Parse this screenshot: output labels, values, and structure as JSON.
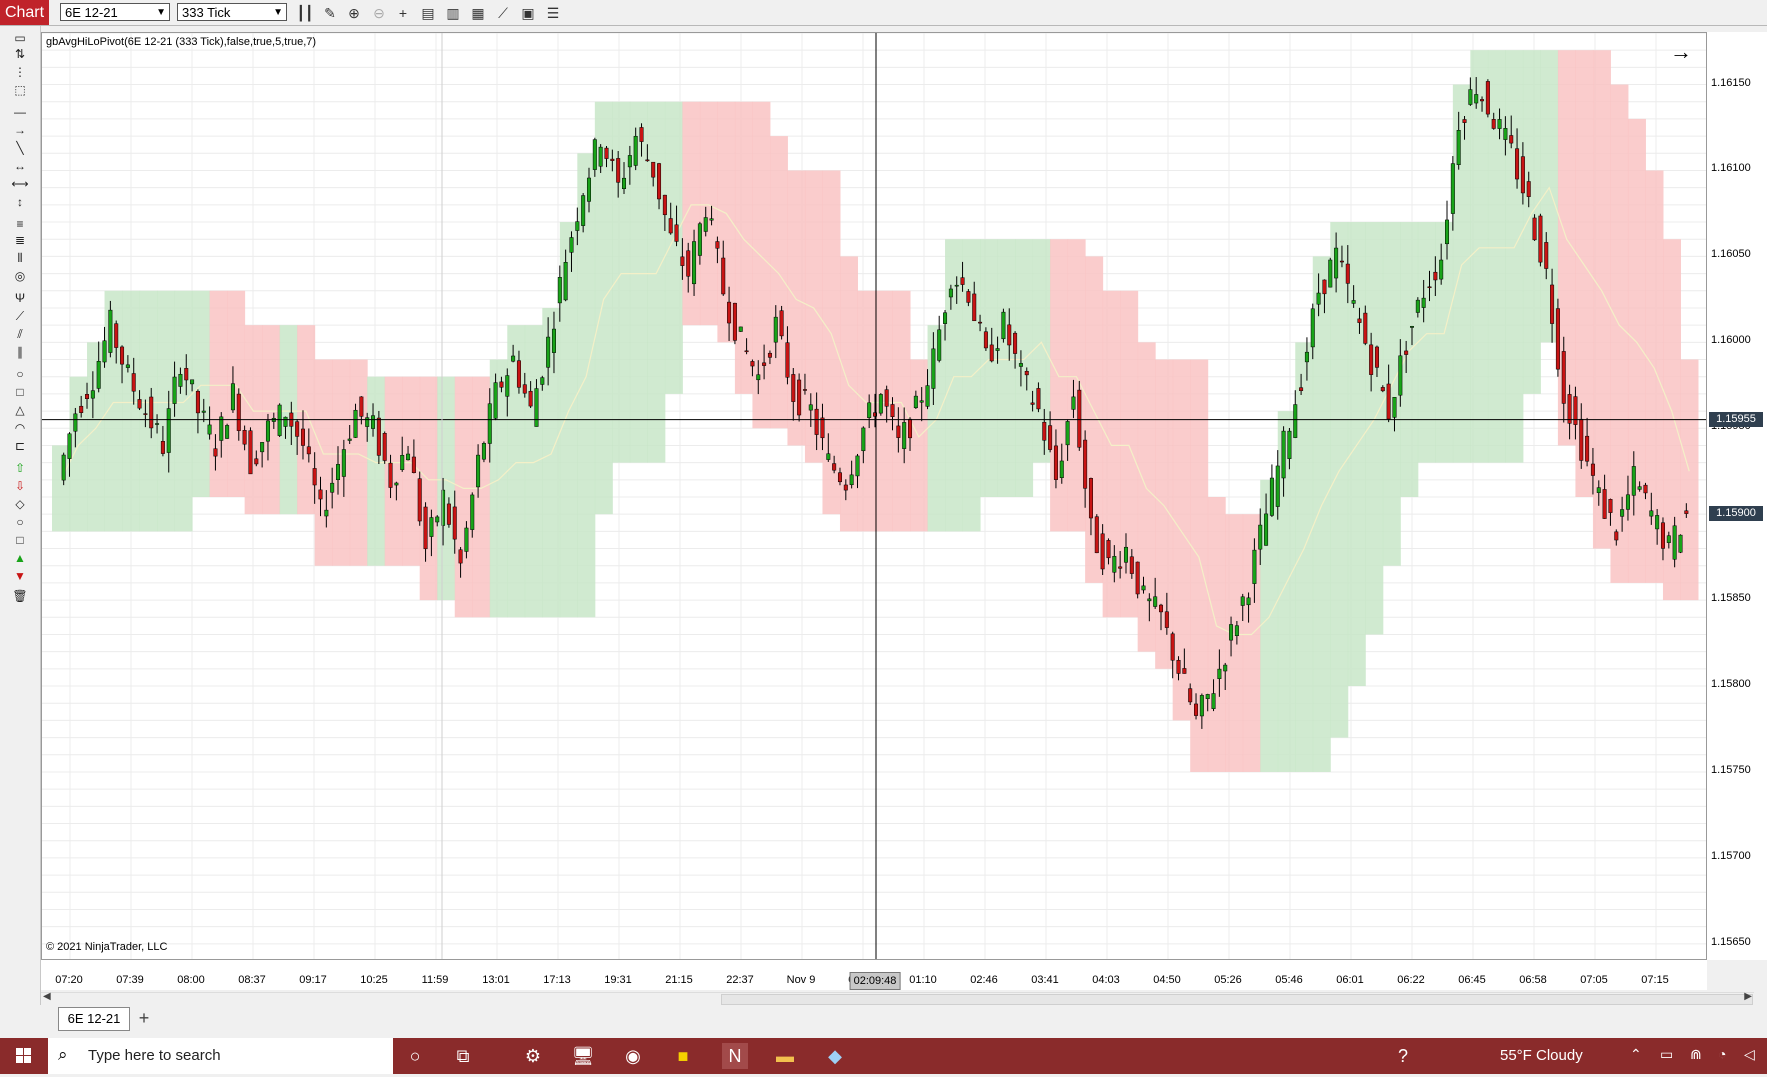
{
  "toolbar": {
    "chart_label": "Chart",
    "instrument": "6E 12-21",
    "interval": "333 Tick",
    "icons": [
      "bars-icon",
      "pencil-icon",
      "zoom-in-icon",
      "zoom-out-icon",
      "crosshair-icon",
      "properties-icon",
      "indicators-icon",
      "strategies-icon",
      "drawing-icon",
      "templates-icon",
      "data-series-icon"
    ]
  },
  "chart": {
    "indicator_label": "gbAvgHiLoPivot(6E 12-21 (333 Tick),false,true,5,true,7)",
    "copyright": "© 2021 NinjaTrader, LLC",
    "crosshair_price": "1.15955",
    "last_price": "1.15900",
    "crosshair_time": "02:09:48",
    "colors": {
      "up": "#19a319",
      "down": "#c81414",
      "green_zone": "#c8e6c8",
      "red_zone": "#f9c3c3"
    }
  },
  "chart_data": {
    "type": "candlestick",
    "instrument": "6E 12-21",
    "ylim": [
      1.1564,
      1.1618
    ],
    "y_ticks": [
      "1.16150",
      "1.16100",
      "1.16050",
      "1.16000",
      "1.15950",
      "1.15900",
      "1.15850",
      "1.15800",
      "1.15750",
      "1.15700",
      "1.15650"
    ],
    "x_ticks": [
      "07:20",
      "07:39",
      "08:00",
      "08:37",
      "09:17",
      "10:25",
      "11:59",
      "13:01",
      "17:13",
      "19:31",
      "21:15",
      "22:37",
      "Nov 9",
      "00:27",
      "01:10",
      "02:46",
      "03:41",
      "04:03",
      "04:50",
      "05:26",
      "05:46",
      "06:01",
      "06:22",
      "06:45",
      "06:58",
      "07:05",
      "07:15"
    ],
    "close_path": [
      1.1592,
      1.1596,
      1.1598,
      1.1601,
      1.1598,
      1.1596,
      1.1594,
      1.1599,
      1.1596,
      1.1594,
      1.1597,
      1.1593,
      1.1595,
      1.1596,
      1.1594,
      1.159,
      1.1593,
      1.1596,
      1.1595,
      1.1592,
      1.1594,
      1.1588,
      1.1591,
      1.1587,
      1.1593,
      1.1597,
      1.1599,
      1.1596,
      1.16,
      1.1605,
      1.1609,
      1.1612,
      1.1609,
      1.1612,
      1.161,
      1.1606,
      1.1604,
      1.1608,
      1.1603,
      1.16,
      1.1598,
      1.1601,
      1.1597,
      1.1596,
      1.1593,
      1.1592,
      1.1595,
      1.1597,
      1.1594,
      1.1596,
      1.1599,
      1.1604,
      1.1603,
      1.1599,
      1.1601,
      1.1598,
      1.1596,
      1.1592,
      1.1597,
      1.1589,
      1.1587,
      1.1588,
      1.1585,
      1.1584,
      1.1581,
      1.1578,
      1.158,
      1.1583,
      1.1586,
      1.159,
      1.1594,
      1.1598,
      1.1603,
      1.1605,
      1.1602,
      1.1599,
      1.1596,
      1.16,
      1.1603,
      1.1605,
      1.1613,
      1.1615,
      1.1613,
      1.1611,
      1.1608,
      1.1604,
      1.1597,
      1.1594,
      1.1591,
      1.1589,
      1.1592,
      1.159,
      1.1588,
      1.159
    ]
  },
  "tabs": {
    "active": "6E 12-21",
    "add": "+"
  },
  "taskbar": {
    "search_placeholder": "Type here to search",
    "weather": "55°F  Cloudy"
  }
}
